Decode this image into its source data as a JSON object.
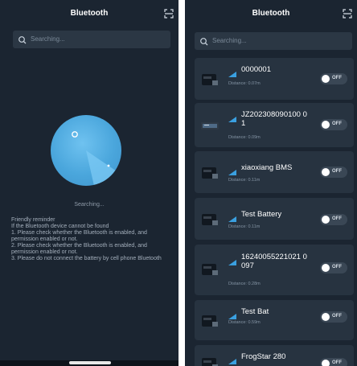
{
  "left_screen": {
    "title": "Bluetooth",
    "search": {
      "placeholder": "Searching..."
    },
    "radar": {
      "status": "Searching..."
    },
    "reminder": {
      "lines": [
        "Friendly reminder",
        "If the Bluetooth device cannot be found",
        "1. Please check whether the Bluetooth is enabled, and permission enabled or not.",
        "2. Please check whether the Bluetooth is enabled, and permission enabled or not.",
        "3. Please do not connect the battery by cell phone Bluetooth"
      ]
    }
  },
  "right_screen": {
    "title": "Bluetooth",
    "search": {
      "placeholder": "Searching..."
    },
    "devices": [
      {
        "name": "0000001",
        "distance": "Distance: 0.07m",
        "toggle": "OFF"
      },
      {
        "name": "JZ202308090100 01",
        "distance": "Distance: 0.09m",
        "toggle": "OFF"
      },
      {
        "name": "xiaoxiang BMS",
        "distance": "Distance: 0.11m",
        "toggle": "OFF"
      },
      {
        "name": "Test Battery",
        "distance": "Distance: 0.11m",
        "toggle": "OFF"
      },
      {
        "name": "16240055221021 0097",
        "distance": "Distance: 0.28m",
        "toggle": "OFF"
      },
      {
        "name": "Test Bat",
        "distance": "Distance: 0.59m",
        "toggle": "OFF"
      },
      {
        "name": "FrogStar 280",
        "distance": "",
        "toggle": "OFF"
      }
    ]
  },
  "colors": {
    "background": "#1b2531",
    "card": "#273340",
    "accent": "#4aa6dc",
    "signal": "#3aa0e0"
  },
  "icons": {
    "scan": "scan-icon",
    "search": "search-icon",
    "signal": "signal-icon",
    "battery": "battery-thumbnail-icon"
  }
}
